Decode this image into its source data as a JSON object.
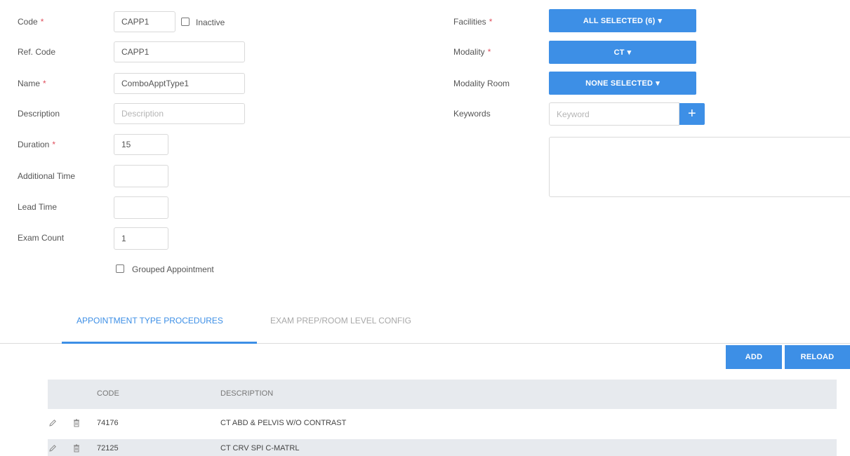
{
  "form": {
    "code_label": "Code",
    "code_value": "CAPP1",
    "inactive_label": "Inactive",
    "refcode_label": "Ref. Code",
    "refcode_value": "CAPP1",
    "name_label": "Name",
    "name_value": "ComboApptType1",
    "description_label": "Description",
    "description_placeholder": "Description",
    "duration_label": "Duration",
    "duration_value": "15",
    "additional_time_label": "Additional Time",
    "additional_time_value": "",
    "lead_time_label": "Lead Time",
    "lead_time_value": "",
    "exam_count_label": "Exam Count",
    "exam_count_value": "1",
    "grouped_label": "Grouped Appointment",
    "required_mark": "*"
  },
  "right": {
    "facilities_label": "Facilities",
    "facilities_button": "ALL SELECTED (6)",
    "modality_label": "Modality",
    "modality_button": "CT",
    "modality_room_label": "Modality Room",
    "modality_room_button": "NONE SELECTED",
    "keywords_label": "Keywords",
    "keyword_placeholder": "Keyword",
    "add_keyword_symbol": "+"
  },
  "tabs": [
    {
      "label": "APPOINTMENT TYPE PROCEDURES",
      "active": true
    },
    {
      "label": "EXAM PREP/ROOM LEVEL CONFIG",
      "active": false
    }
  ],
  "toolbar": {
    "add_label": "ADD",
    "reload_label": "RELOAD"
  },
  "table": {
    "columns": [
      "CODE",
      "DESCRIPTION"
    ],
    "rows": [
      {
        "code": "74176",
        "description": "CT ABD & PELVIS W/O CONTRAST"
      },
      {
        "code": "72125",
        "description": "CT CRV SPI C-MATRL"
      }
    ]
  },
  "colors": {
    "accent": "#3d8fe6",
    "required": "#e0505e",
    "tab_active": "#3d8fe6",
    "header_bg": "#e7eaee"
  }
}
